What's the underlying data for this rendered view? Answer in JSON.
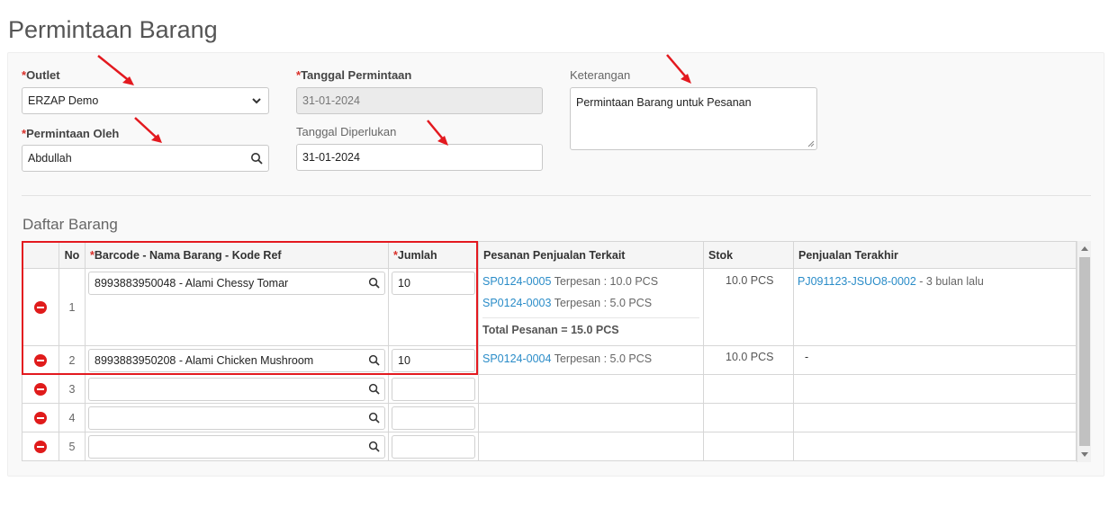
{
  "page": {
    "title": "Permintaan Barang"
  },
  "form": {
    "outlet": {
      "label": "Outlet",
      "value": "ERZAP Demo"
    },
    "tanggal_permintaan": {
      "label": "Tanggal Permintaan",
      "value": "31-01-2024"
    },
    "keterangan": {
      "label": "Keterangan",
      "value": "Permintaan Barang untuk Pesanan"
    },
    "permintaan_oleh": {
      "label": "Permintaan Oleh",
      "value": "Abdullah"
    },
    "tanggal_diperlukan": {
      "label": "Tanggal Diperlukan",
      "value": "31-01-2024"
    },
    "required_marker": "*"
  },
  "daftar": {
    "title": "Daftar Barang",
    "headers": {
      "no": "No",
      "barcode": "Barcode - Nama Barang - Kode Ref",
      "jumlah": "Jumlah",
      "pesanan": "Pesanan Penjualan Terkait",
      "stok": "Stok",
      "penjualan": "Penjualan Terakhir"
    },
    "rows": [
      {
        "no": "1",
        "barcode": "8993883950048 - Alami Chessy Tomar",
        "jumlah": "10",
        "pesanan": [
          {
            "ref": "SP0124-0005",
            "text": "Terpesan : 10.0 PCS"
          },
          {
            "ref": "SP0124-0003",
            "text": "Terpesan : 5.0 PCS"
          }
        ],
        "total": "Total Pesanan = 15.0 PCS",
        "stok": "10.0 PCS",
        "penjualan_ref": "PJ091123-JSUO8-0002",
        "penjualan_text": " - 3 bulan lalu"
      },
      {
        "no": "2",
        "barcode": "8993883950208 - Alami Chicken Mushroom",
        "jumlah": "10",
        "pesanan": [
          {
            "ref": "SP0124-0004",
            "text": "Terpesan : 5.0 PCS"
          }
        ],
        "stok": "10.0 PCS",
        "penjualan_text": "-"
      },
      {
        "no": "3",
        "barcode": "",
        "jumlah": ""
      },
      {
        "no": "4",
        "barcode": "",
        "jumlah": ""
      },
      {
        "no": "5",
        "barcode": "",
        "jumlah": ""
      }
    ]
  },
  "colors": {
    "required": "#d9302a",
    "link": "#2a8cc8",
    "delete": "#e01b1b",
    "highlight": "#e3191f"
  }
}
